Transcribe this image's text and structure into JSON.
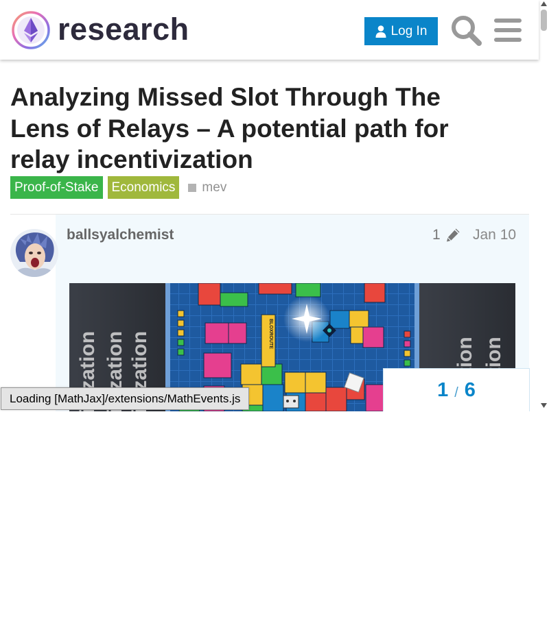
{
  "header": {
    "logo_text": "research",
    "login_label": "Log In",
    "icons": {
      "login": "user-icon",
      "search": "search-icon",
      "menu": "hamburger-menu-icon"
    },
    "accent_color": "#0a85c9"
  },
  "topic": {
    "title": "Analyzing Missed Slot Through The Lens of Relays – A potential path for relay incentivization",
    "categories": [
      {
        "label": "Proof-of-Stake",
        "color": "#3ab54a"
      },
      {
        "label": "Economics",
        "color": "#a0b83c"
      }
    ],
    "tags": [
      {
        "label": "mev"
      }
    ]
  },
  "post": {
    "username": "ballsyalchemist",
    "edit_count": "1",
    "edit_icon": "pencil-icon",
    "date": "Jan 10",
    "image_words": {
      "left": "ivization",
      "right": "vization",
      "sticker": "BLOXROUTE"
    }
  },
  "progress": {
    "current": "1",
    "separator": "/",
    "total": "6"
  },
  "status": {
    "mathjax_loading": "Loading [MathJax]/extensions/MathEvents.js"
  }
}
